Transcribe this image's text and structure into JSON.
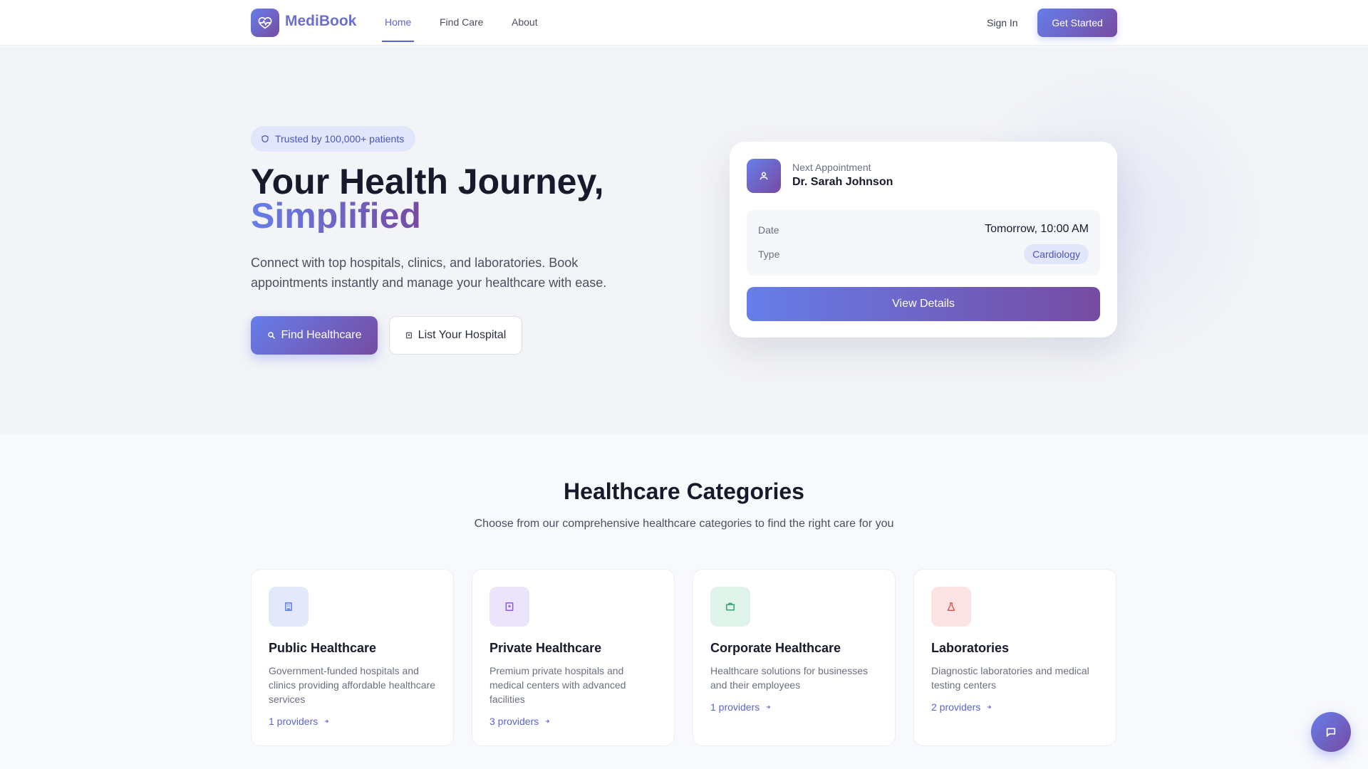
{
  "nav": {
    "logo": "MediBook",
    "logo_icon": "heart-pulse-icon",
    "links": [
      "Home",
      "Find Care",
      "About"
    ],
    "active_link": "Home",
    "sign_in": "Sign In",
    "get_started": "Get Started"
  },
  "hero": {
    "badge": "Trusted by 100,000+ patients",
    "badge_icon": "shield-check-icon",
    "title_line1": "Your Health Journey,",
    "title_line2": "Simplified",
    "description": "Connect with top hospitals, clinics, and laboratories. Book appointments instantly and manage your healthcare with ease.",
    "primary_button": "Find Healthcare",
    "primary_icon": "search-icon",
    "secondary_button": "List Your Hospital",
    "secondary_icon": "hospital-icon"
  },
  "appointment": {
    "label": "Next Appointment",
    "doctor": "Dr. Sarah Johnson",
    "icon": "doctor-icon",
    "date_label": "Date",
    "date_value": "Tomorrow, 10:00 AM",
    "type_label": "Type",
    "type_value": "Cardiology",
    "button": "View Details"
  },
  "categories": {
    "title": "Healthcare Categories",
    "subtitle": "Choose from our comprehensive healthcare categories to find the right care for you",
    "items": [
      {
        "title": "Public Healthcare",
        "description": "Government-funded hospitals and clinics providing affordable healthcare services",
        "providers": "1 providers",
        "icon": "building-icon",
        "color": "#5b7be0",
        "bg": "#e3e8fb"
      },
      {
        "title": "Private Healthcare",
        "description": "Premium private hospitals and medical centers with advanced facilities",
        "providers": "3 providers",
        "icon": "hospital-icon",
        "color": "#8a5bd6",
        "bg": "#ece4fb"
      },
      {
        "title": "Corporate Healthcare",
        "description": "Healthcare solutions for businesses and their employees",
        "providers": "1 providers",
        "icon": "briefcase-icon",
        "color": "#2f9e6e",
        "bg": "#e0f3ea"
      },
      {
        "title": "Laboratories",
        "description": "Diagnostic laboratories and medical testing centers",
        "providers": "2 providers",
        "icon": "flask-icon",
        "color": "#e05454",
        "bg": "#fbe3e3"
      }
    ]
  },
  "fab": {
    "icon": "chat-icon"
  }
}
